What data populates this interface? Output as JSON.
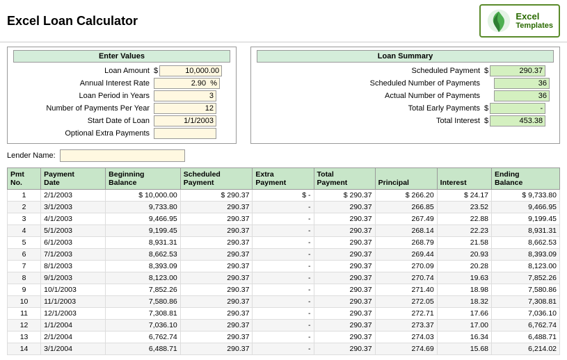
{
  "header": {
    "title": "Excel Loan Calculator",
    "logo_line1": "Excel",
    "logo_line2": "Templates"
  },
  "input_section": {
    "header": "Enter Values",
    "fields": [
      {
        "label": "Loan Amount",
        "currency": "$",
        "value": "10,000.00"
      },
      {
        "label": "Annual Interest Rate",
        "currency": "",
        "value": "2.90  %"
      },
      {
        "label": "Loan Period in Years",
        "currency": "",
        "value": "3"
      },
      {
        "label": "Number of Payments Per Year",
        "currency": "",
        "value": "12"
      },
      {
        "label": "Start Date of Loan",
        "currency": "",
        "value": "1/1/2003"
      },
      {
        "label": "Optional Extra Payments",
        "currency": "",
        "value": ""
      }
    ]
  },
  "summary_section": {
    "header": "Loan Summary",
    "rows": [
      {
        "label": "Scheduled Payment",
        "currency": "$",
        "value": "290.37"
      },
      {
        "label": "Scheduled Number of Payments",
        "currency": "",
        "value": "36"
      },
      {
        "label": "Actual Number of Payments",
        "currency": "",
        "value": "36"
      },
      {
        "label": "Total Early Payments",
        "currency": "$",
        "value": "-"
      },
      {
        "label": "Total Interest",
        "currency": "$",
        "value": "453.38"
      }
    ]
  },
  "lender": {
    "label": "Lender Name:",
    "value": ""
  },
  "table": {
    "columns": [
      {
        "label": "Pmt\nNo.",
        "key": "pmt"
      },
      {
        "label": "Payment\nDate",
        "key": "date"
      },
      {
        "label": "Beginning\nBalance",
        "key": "beg_bal"
      },
      {
        "label": "Scheduled\nPayment",
        "key": "sched_pay"
      },
      {
        "label": "Extra\nPayment",
        "key": "extra_pay"
      },
      {
        "label": "Total\nPayment",
        "key": "total_pay"
      },
      {
        "label": "Principal",
        "key": "principal"
      },
      {
        "label": "Interest",
        "key": "interest"
      },
      {
        "label": "Ending\nBalance",
        "key": "end_bal"
      }
    ],
    "rows": [
      {
        "pmt": "1",
        "date": "2/1/2003",
        "beg_bal": "$ 10,000.00",
        "sched_pay": "$ 290.37",
        "extra_pay": "$ -",
        "total_pay": "$ 290.37",
        "principal": "$ 266.20",
        "interest": "$ 24.17",
        "end_bal": "$ 9,733.80"
      },
      {
        "pmt": "2",
        "date": "3/1/2003",
        "beg_bal": "9,733.80",
        "sched_pay": "290.37",
        "extra_pay": "-",
        "total_pay": "290.37",
        "principal": "266.85",
        "interest": "23.52",
        "end_bal": "9,466.95"
      },
      {
        "pmt": "3",
        "date": "4/1/2003",
        "beg_bal": "9,466.95",
        "sched_pay": "290.37",
        "extra_pay": "-",
        "total_pay": "290.37",
        "principal": "267.49",
        "interest": "22.88",
        "end_bal": "9,199.45"
      },
      {
        "pmt": "4",
        "date": "5/1/2003",
        "beg_bal": "9,199.45",
        "sched_pay": "290.37",
        "extra_pay": "-",
        "total_pay": "290.37",
        "principal": "268.14",
        "interest": "22.23",
        "end_bal": "8,931.31"
      },
      {
        "pmt": "5",
        "date": "6/1/2003",
        "beg_bal": "8,931.31",
        "sched_pay": "290.37",
        "extra_pay": "-",
        "total_pay": "290.37",
        "principal": "268.79",
        "interest": "21.58",
        "end_bal": "8,662.53"
      },
      {
        "pmt": "6",
        "date": "7/1/2003",
        "beg_bal": "8,662.53",
        "sched_pay": "290.37",
        "extra_pay": "-",
        "total_pay": "290.37",
        "principal": "269.44",
        "interest": "20.93",
        "end_bal": "8,393.09"
      },
      {
        "pmt": "7",
        "date": "8/1/2003",
        "beg_bal": "8,393.09",
        "sched_pay": "290.37",
        "extra_pay": "-",
        "total_pay": "290.37",
        "principal": "270.09",
        "interest": "20.28",
        "end_bal": "8,123.00"
      },
      {
        "pmt": "8",
        "date": "9/1/2003",
        "beg_bal": "8,123.00",
        "sched_pay": "290.37",
        "extra_pay": "-",
        "total_pay": "290.37",
        "principal": "270.74",
        "interest": "19.63",
        "end_bal": "7,852.26"
      },
      {
        "pmt": "9",
        "date": "10/1/2003",
        "beg_bal": "7,852.26",
        "sched_pay": "290.37",
        "extra_pay": "-",
        "total_pay": "290.37",
        "principal": "271.40",
        "interest": "18.98",
        "end_bal": "7,580.86"
      },
      {
        "pmt": "10",
        "date": "11/1/2003",
        "beg_bal": "7,580.86",
        "sched_pay": "290.37",
        "extra_pay": "-",
        "total_pay": "290.37",
        "principal": "272.05",
        "interest": "18.32",
        "end_bal": "7,308.81"
      },
      {
        "pmt": "11",
        "date": "12/1/2003",
        "beg_bal": "7,308.81",
        "sched_pay": "290.37",
        "extra_pay": "-",
        "total_pay": "290.37",
        "principal": "272.71",
        "interest": "17.66",
        "end_bal": "7,036.10"
      },
      {
        "pmt": "12",
        "date": "1/1/2004",
        "beg_bal": "7,036.10",
        "sched_pay": "290.37",
        "extra_pay": "-",
        "total_pay": "290.37",
        "principal": "273.37",
        "interest": "17.00",
        "end_bal": "6,762.74"
      },
      {
        "pmt": "13",
        "date": "2/1/2004",
        "beg_bal": "6,762.74",
        "sched_pay": "290.37",
        "extra_pay": "-",
        "total_pay": "290.37",
        "principal": "274.03",
        "interest": "16.34",
        "end_bal": "6,488.71"
      },
      {
        "pmt": "14",
        "date": "3/1/2004",
        "beg_bal": "6,488.71",
        "sched_pay": "290.37",
        "extra_pay": "-",
        "total_pay": "290.37",
        "principal": "274.69",
        "interest": "15.68",
        "end_bal": "6,214.02"
      }
    ]
  }
}
